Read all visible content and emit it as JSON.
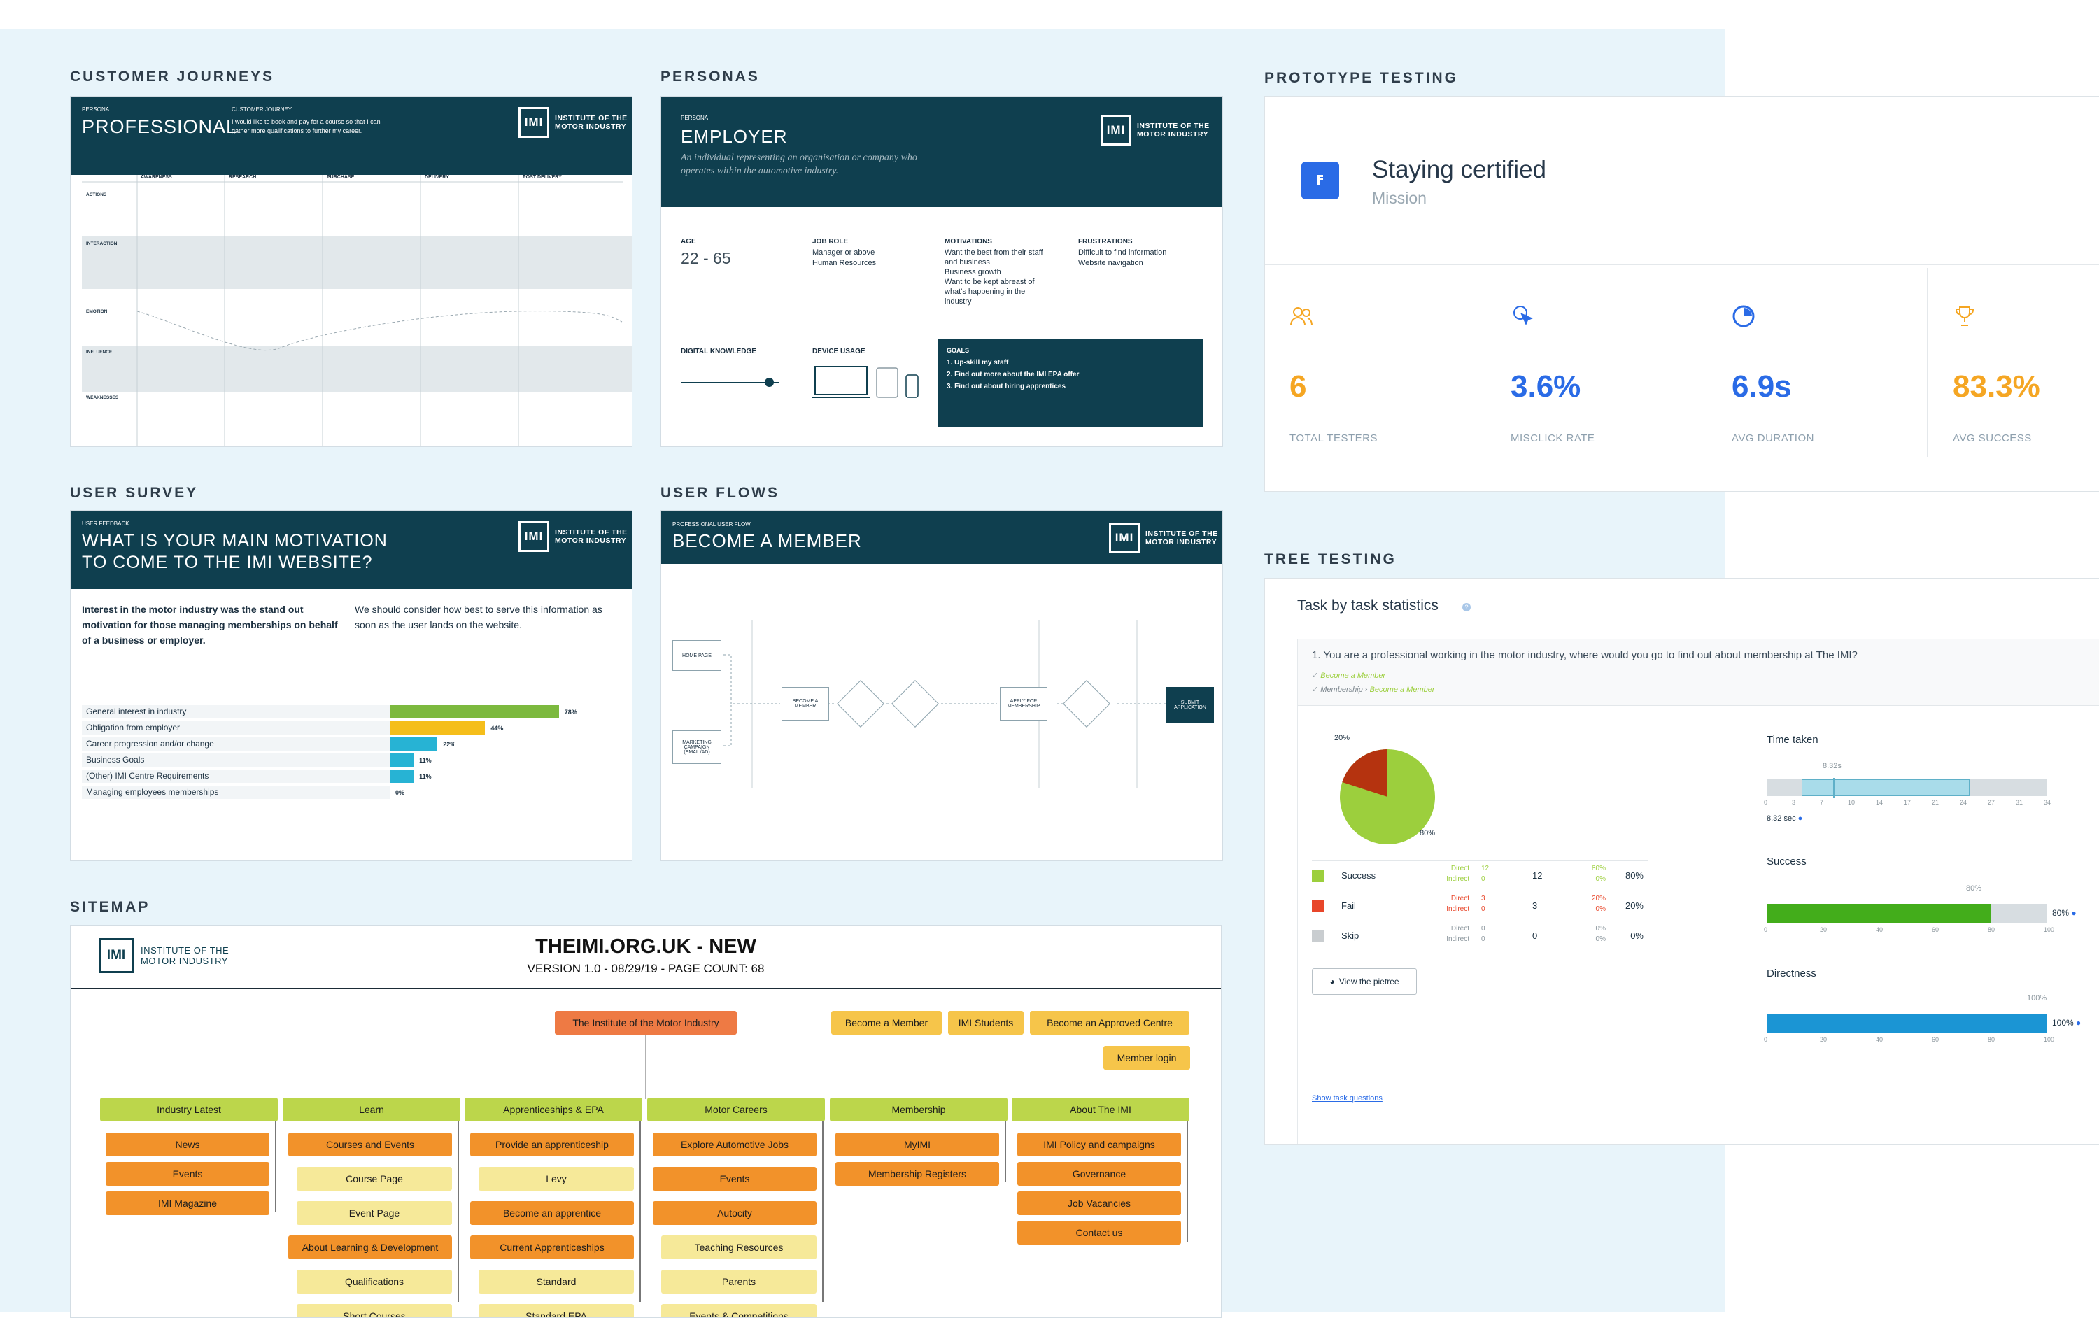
{
  "sections": {
    "customer_journeys": "CUSTOMER JOURNEYS",
    "personas": "PERSONAS",
    "prototype_testing": "PROTOTYPE TESTING",
    "user_survey": "USER SURVEY",
    "user_flows": "USER FLOWS",
    "tree_testing": "TREE TESTING",
    "sitemap": "SITEMAP"
  },
  "logo": {
    "abbr": "IMI",
    "line1": "INSTITUTE OF THE",
    "line2": "MOTOR INDUSTRY"
  },
  "journey": {
    "persona_label": "PERSONA",
    "persona": "PROFESSIONAL",
    "cj_label": "CUSTOMER JOURNEY",
    "cj_text": "I would like to book and pay for a course so that I can gather more qualifications to further my career.",
    "stages": [
      "AWARENESS",
      "RESEARCH",
      "PURCHASE",
      "DELIVERY",
      "POST DELIVERY"
    ],
    "rows": [
      "ACTIONS",
      "INTERACTION",
      "EMOTION",
      "INFLUENCE",
      "WEAKNESSES"
    ]
  },
  "persona": {
    "label": "PERSONA",
    "name": "EMPLOYER",
    "desc": "An individual representing an organisation or company who operates within the automotive industry.",
    "age_label": "AGE",
    "age": "22 - 65",
    "job_label": "JOB ROLE",
    "job": [
      "Manager or above",
      "Human Resources"
    ],
    "motivations_label": "MOTIVATIONS",
    "motivations": [
      "Want the best from their staff and business",
      "Business growth",
      "Want to be kept abreast of what's happening in the industry"
    ],
    "frustrations_label": "FRUSTRATIONS",
    "frustrations": [
      "Difficult to find information",
      "Website navigation"
    ],
    "digital_label": "DIGITAL KNOWLEDGE",
    "device_label": "DEVICE USAGE",
    "goals_label": "GOALS",
    "goals": [
      "1.  Up-skill my staff",
      "2.  Find out more about the IMI EPA offer",
      "3.  Find out about hiring apprentices"
    ]
  },
  "prototype": {
    "title": "Staying certified",
    "subtitle": "Mission",
    "metrics": [
      {
        "value": "6",
        "label": "TOTAL TESTERS",
        "color": "#f5a623",
        "icon": "users-icon"
      },
      {
        "value": "3.6%",
        "label": "MISCLICK RATE",
        "color": "#2a6be6",
        "icon": "cursor-click-icon"
      },
      {
        "value": "6.9s",
        "label": "AVG DURATION",
        "color": "#2a6be6",
        "icon": "clock-pie-icon"
      },
      {
        "value": "83.3%",
        "label": "AVG SUCCESS",
        "color": "#f5a623",
        "icon": "trophy-icon"
      }
    ]
  },
  "survey": {
    "label": "USER FEEDBACK",
    "title1": "WHAT IS YOUR MAIN MOTIVATION",
    "title2": "TO COME TO THE IMI WEBSITE?",
    "left_text": "Interest in the motor industry was the stand out motivation for those managing memberships on behalf of a business or employer.",
    "right_text": "We should consider how best to serve this information as soon as the user lands on the website.",
    "bars": [
      {
        "label": "General interest in industry",
        "pct": "78%",
        "value": 78,
        "color": "#7cb93e"
      },
      {
        "label": "Obligation from employer",
        "pct": "44%",
        "value": 44,
        "color": "#f5be1b"
      },
      {
        "label": "Career progression and/or change",
        "pct": "22%",
        "value": 22,
        "color": "#27b3d4"
      },
      {
        "label": "Business Goals",
        "pct": "11%",
        "value": 11,
        "color": "#27b3d4"
      },
      {
        "label": "(Other) IMI Centre Requirements",
        "pct": "11%",
        "value": 11,
        "color": "#27b3d4"
      },
      {
        "label": "Managing employees memberships",
        "pct": "0%",
        "value": 0,
        "color": "#27b3d4"
      }
    ]
  },
  "flows": {
    "label": "PROFESSIONAL USER FLOW",
    "title": "BECOME A MEMBER",
    "nodes": [
      "HOME PAGE",
      "MARKETING CAMPAIGN (EMAIL/AD)",
      "BECOME A MEMBER",
      "APPLY FOR MEMBERSHIP",
      "SUBMIT APPLICATION"
    ]
  },
  "tree": {
    "title": "Task by task statistics",
    "question": "1. You are a professional working in the motor industry, where would you go to find out about membership at The IMI?",
    "path1": "Become a Member",
    "path2a": "Membership",
    "path2b": "Become a Member",
    "pie_fail": "20%",
    "pie_success": "80%",
    "rows": [
      {
        "name": "Success",
        "color": "#9ccf3d",
        "d": "Direct",
        "i": "Indirect",
        "dn": "12",
        "in": "0",
        "n": "12",
        "dp": "80%",
        "ip": "0%",
        "p": "80%"
      },
      {
        "name": "Fail",
        "color": "#e8462a",
        "d": "Direct",
        "i": "Indirect",
        "dn": "3",
        "in": "0",
        "n": "3",
        "dp": "20%",
        "ip": "0%",
        "p": "20%"
      },
      {
        "name": "Skip",
        "color": "#c9cdd0",
        "d": "Direct",
        "i": "Indirect",
        "dn": "0",
        "in": "0",
        "n": "0",
        "dp": "0%",
        "ip": "0%",
        "p": "0%"
      }
    ],
    "view_btn": "View the pietree",
    "show_link": "Show task questions",
    "time_label": "Time taken",
    "time_value": "8.32s",
    "time_sec": "8.32 sec",
    "time_ticks": [
      "0",
      "3",
      "7",
      "10",
      "14",
      "17",
      "21",
      "24",
      "27",
      "31",
      "34"
    ],
    "success_label": "Success",
    "success_pct": "80%",
    "direct_label": "Directness",
    "direct_pct": "100%",
    "pct_ticks": [
      "0",
      "20",
      "40",
      "60",
      "80",
      "100"
    ]
  },
  "sitemap": {
    "title": "THEIMI.ORG.UK - NEW",
    "sub": "VERSION 1.0 - 08/29/19 - PAGE COUNT: 68",
    "root": "The Institute of the Motor Industry",
    "top_right": [
      "Become a Member",
      "IMI Students",
      "Become an Approved Centre",
      "Member login"
    ],
    "columns": [
      {
        "head": "Industry Latest",
        "items": [
          [
            "News",
            "orange"
          ],
          [
            "Events",
            "orange"
          ],
          [
            "IMI Magazine",
            "orange"
          ]
        ]
      },
      {
        "head": "Learn",
        "items": [
          [
            "Courses and Events",
            "orange"
          ],
          [
            "Course Page",
            "yellow"
          ],
          [
            "Event Page",
            "yellow"
          ],
          [
            "About Learning & Development",
            "orange"
          ],
          [
            "Qualifications",
            "yellow"
          ],
          [
            "Short Courses",
            "yellow"
          ]
        ]
      },
      {
        "head": "Apprenticeships & EPA",
        "items": [
          [
            "Provide an apprenticeship",
            "orange"
          ],
          [
            "Levy",
            "yellow"
          ],
          [
            "Become an apprentice",
            "orange"
          ],
          [
            "Current Apprenticeships",
            "orange"
          ],
          [
            "Standard",
            "yellow"
          ],
          [
            "Standard EPA",
            "yellow"
          ]
        ]
      },
      {
        "head": "Motor Careers",
        "items": [
          [
            "Explore Automotive Jobs",
            "orange"
          ],
          [
            "Events",
            "orange"
          ],
          [
            "Autocity",
            "orange"
          ],
          [
            "Teaching Resources",
            "yellow"
          ],
          [
            "Parents",
            "yellow"
          ],
          [
            "Events & Competitions",
            "yellow"
          ]
        ]
      },
      {
        "head": "Membership",
        "items": [
          [
            "MyIMI",
            "orange"
          ],
          [
            "Membership Registers",
            "orange"
          ]
        ]
      },
      {
        "head": "About The IMI",
        "items": [
          [
            "IMI Policy and campaigns",
            "orange"
          ],
          [
            "Governance",
            "orange"
          ],
          [
            "Job Vacancies",
            "orange"
          ],
          [
            "Contact us",
            "orange"
          ]
        ]
      }
    ]
  }
}
